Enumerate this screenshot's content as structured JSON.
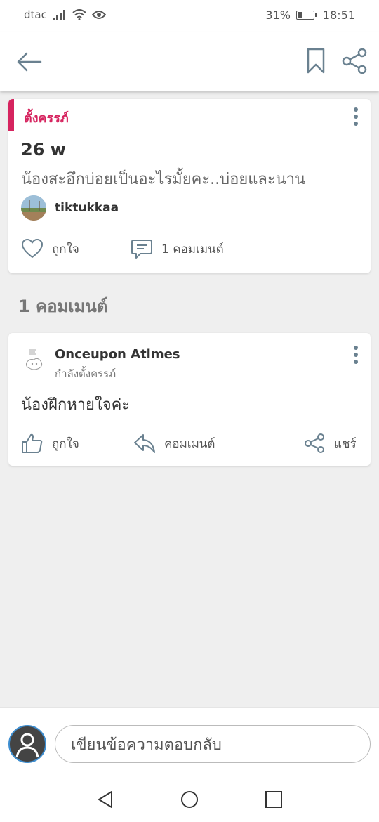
{
  "status_bar": {
    "carrier": "dtac",
    "battery_percent": "31%",
    "battery_level": 0.31,
    "time": "18:51"
  },
  "app_bar": {
    "icons": [
      "back-arrow-icon",
      "bookmark-icon",
      "share-icon"
    ]
  },
  "post": {
    "category": "ตั้งครรภ์",
    "week": "26 w",
    "question": "น้องสะอึกบ่อยเป็นอะไรมั้ยคะ..บ่อยและนาน",
    "author": "tiktukkaa",
    "like_label": "ถูกใจ",
    "comment_label": "1 คอมเมนต์"
  },
  "comments_section": {
    "heading": "1 คอมเมนต์"
  },
  "comment": {
    "author": "Onceupon Atimes",
    "status": "กำลังตั้งครรภ์",
    "body": "น้องฝึกหายใจค่ะ",
    "like_label": "ถูกใจ",
    "reply_label": "คอมเมนต์",
    "share_label": "แชร์"
  },
  "reply_bar": {
    "placeholder": "เขียนข้อความตอบกลับ"
  },
  "colors": {
    "accent": "#d6245f",
    "icon": "#6a8190"
  }
}
